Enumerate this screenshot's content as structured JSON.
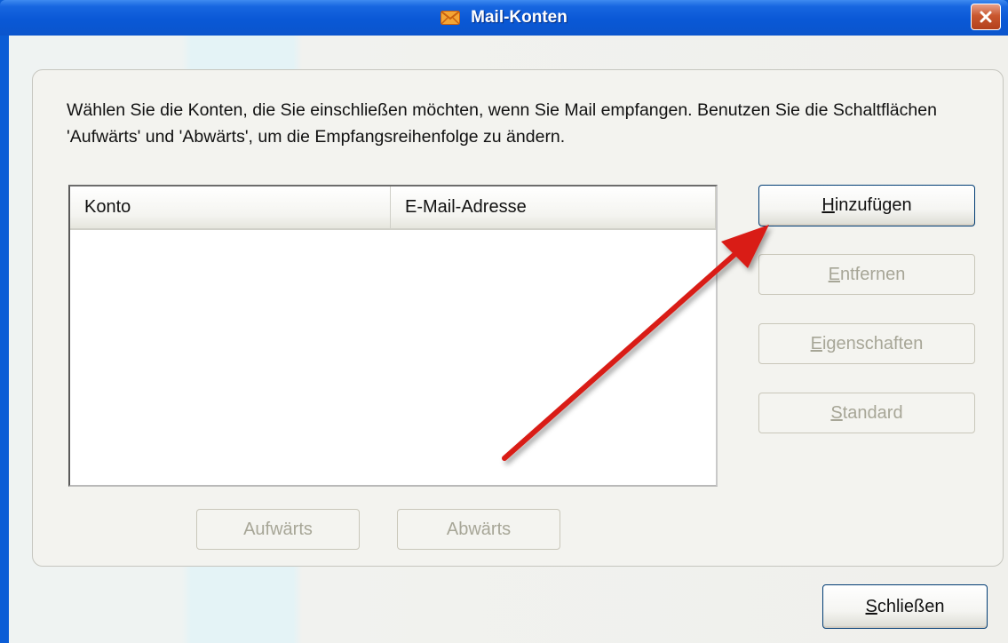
{
  "window": {
    "title": "Mail-Konten",
    "title_icon": "envelope-icon",
    "close_icon": "close-icon",
    "accent_color": "#0b5dd6"
  },
  "instruction": "Wählen Sie die Konten, die Sie einschließen möchten, wenn Sie Mail empfangen. Benutzen Sie die Schaltflächen 'Aufwärts' und 'Abwärts', um die Empfangsreihenfolge zu ändern.",
  "accounts_list": {
    "columns": [
      "Konto",
      "E-Mail-Adresse"
    ],
    "rows": []
  },
  "side_buttons": [
    {
      "label": "Hinzufügen",
      "mnemonic": "H",
      "rest": "inzufügen",
      "enabled": true
    },
    {
      "label": "Entfernen",
      "mnemonic": "E",
      "rest": "ntfernen",
      "enabled": false
    },
    {
      "label": "Eigenschaften",
      "mnemonic": "E",
      "rest": "igenschaften",
      "enabled": false
    },
    {
      "label": "Standard",
      "mnemonic": "S",
      "rest": "tandard",
      "enabled": false
    }
  ],
  "order_buttons": {
    "up": "Aufwärts",
    "down": "Abwärts"
  },
  "close_button": {
    "label": "Schließen",
    "mnemonic": "S",
    "rest": "chließen"
  },
  "annotation": {
    "type": "arrow",
    "color": "#d91e18",
    "points_to": "Hinzufügen"
  }
}
